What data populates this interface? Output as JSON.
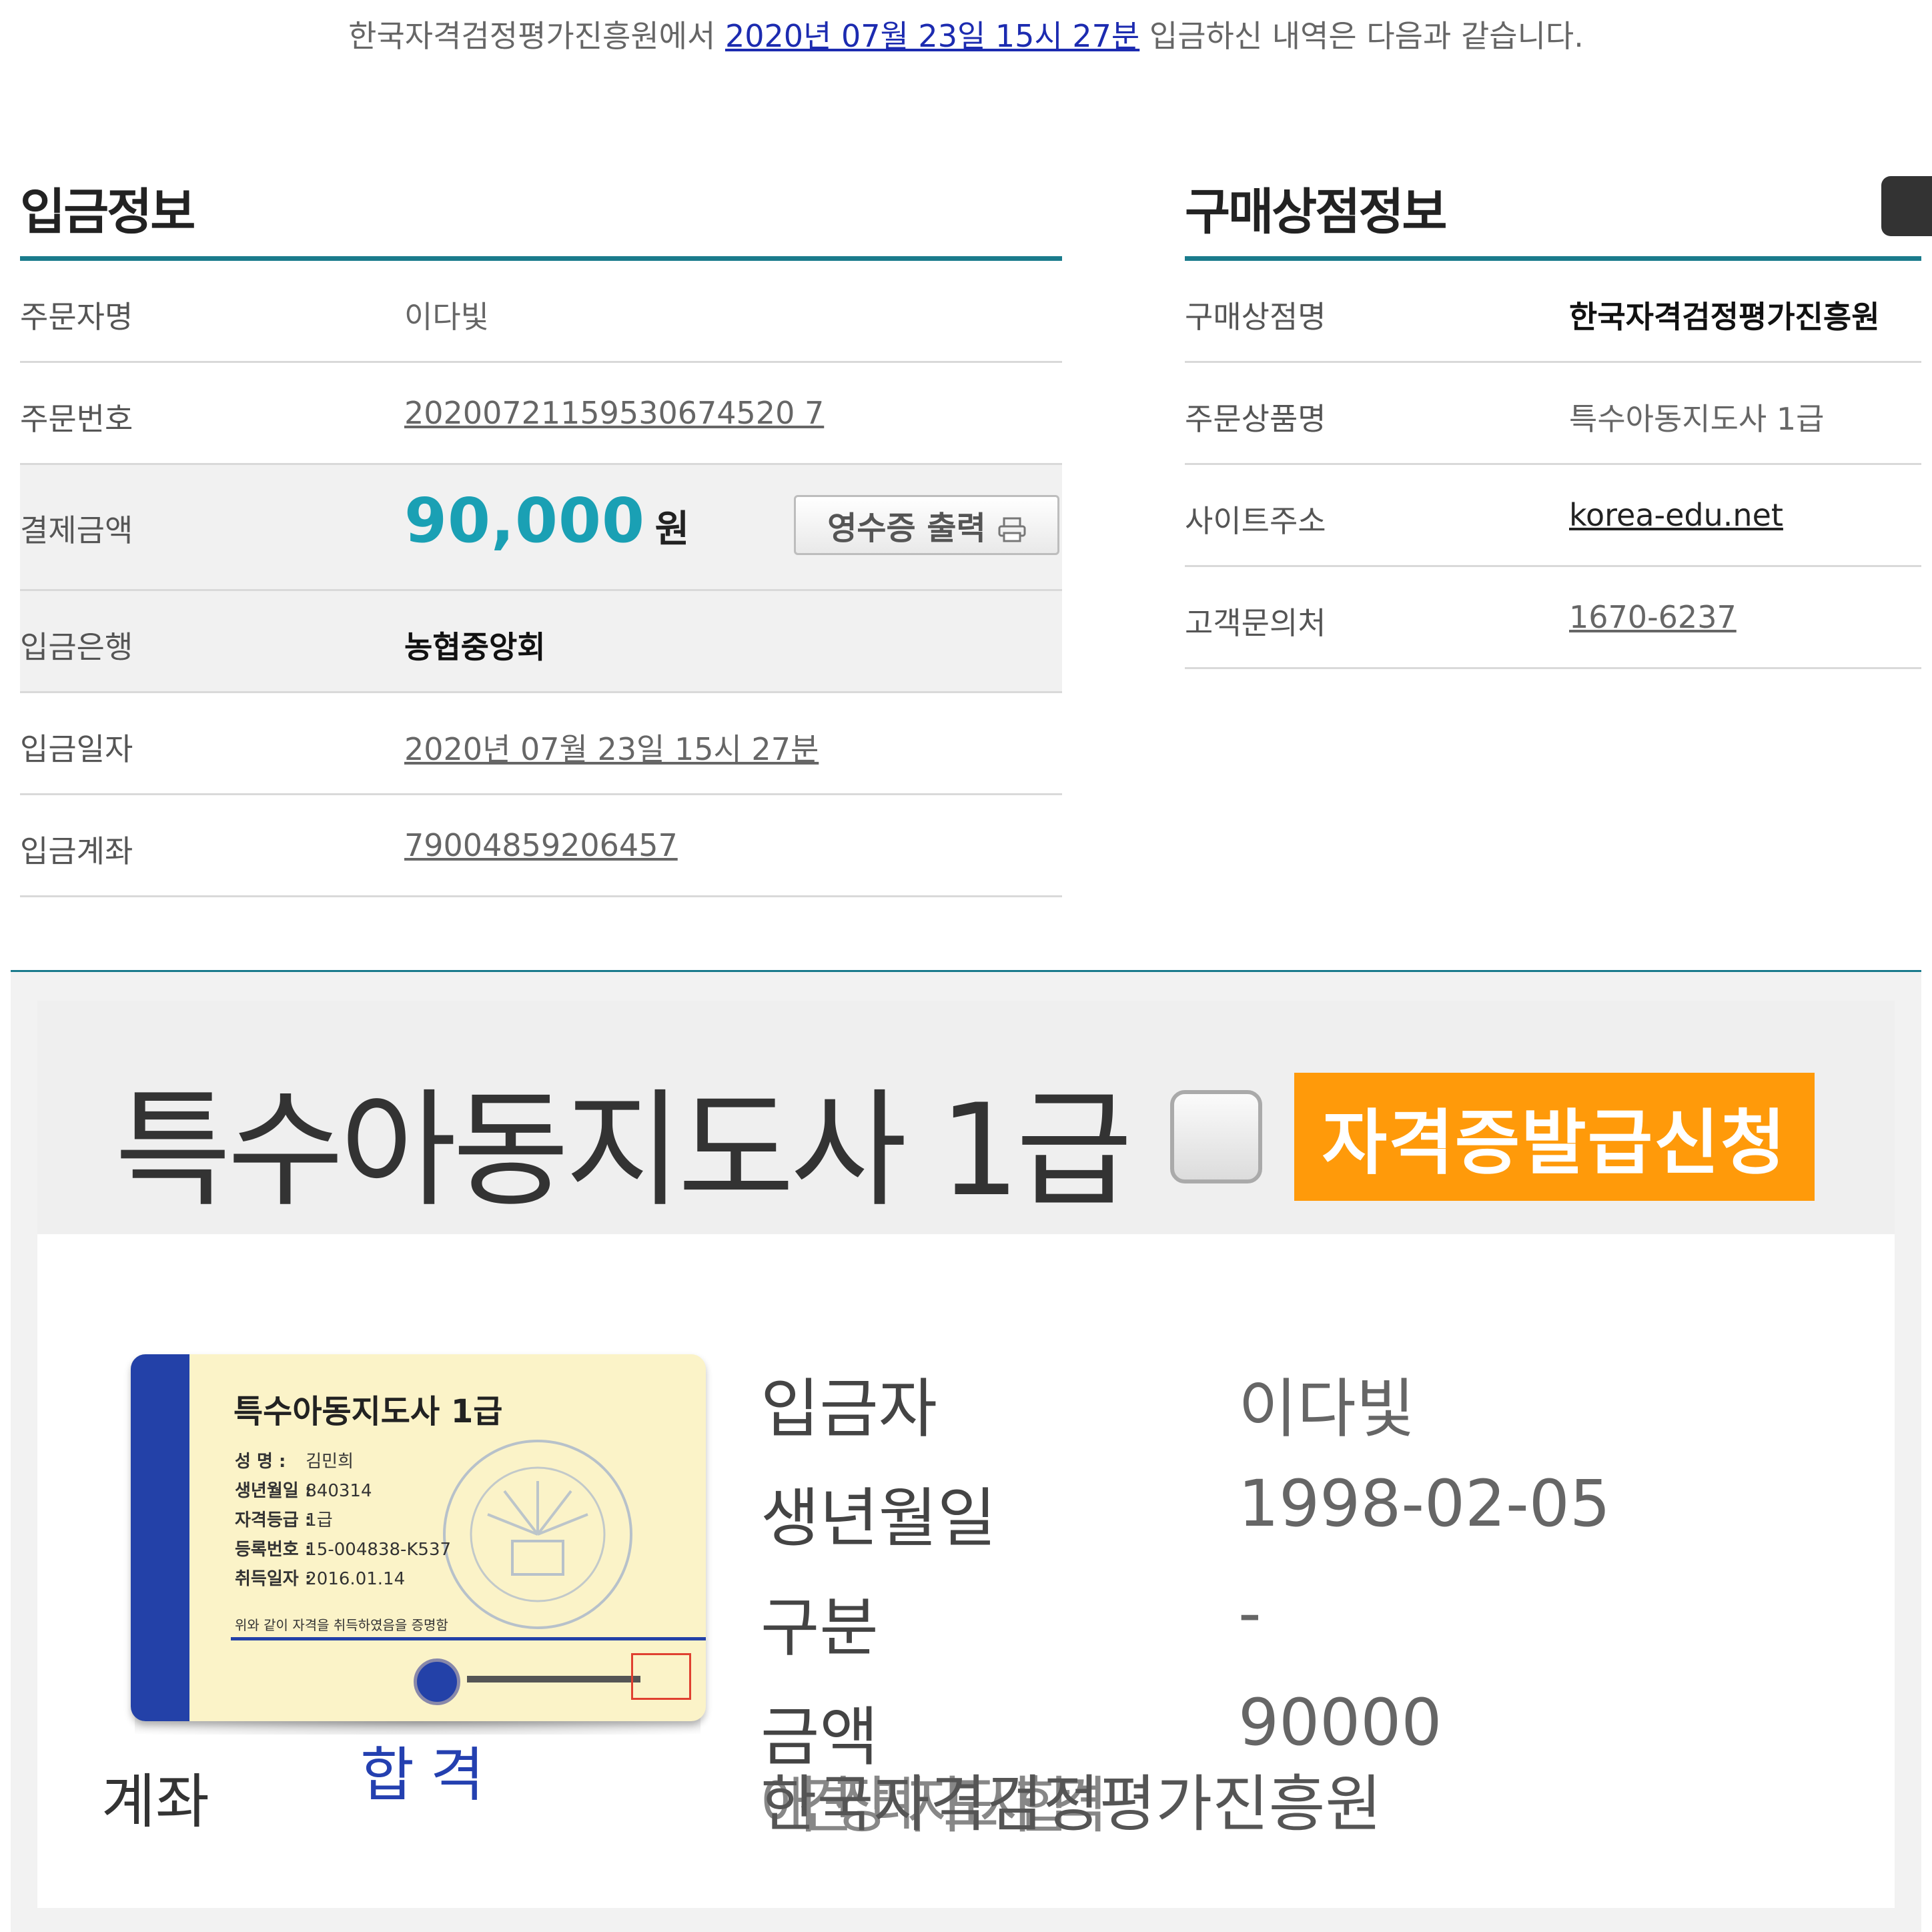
{
  "intro": {
    "prefix": "한국자격검정평가진흥원에서 ",
    "date_link": "2020년 07월 23일 15시 27분",
    "suffix": " 입금하신 내역은 다음과 같습니다."
  },
  "deposit_info": {
    "title": "입금정보",
    "rows": [
      {
        "label": "주문자명",
        "value": "이다빛"
      },
      {
        "label": "주문번호",
        "value": "20200721159530674520 7"
      },
      {
        "label": "결제금액",
        "value": "90,000",
        "unit": "원"
      },
      {
        "label": "입금은행",
        "value": "농협중앙회"
      },
      {
        "label": "입금일자",
        "value": "2020년 07월 23일 15시 27분"
      },
      {
        "label": "입금계좌",
        "value": "79004859206457"
      }
    ],
    "receipt_button": "영수증 출력"
  },
  "store_info": {
    "title": "구매상점정보",
    "rows": [
      {
        "label": "구매상점명",
        "value": "한국자격검정평가진흥원"
      },
      {
        "label": "주문상품명",
        "value": "특수아동지도사 1급"
      },
      {
        "label": "사이트주소",
        "value": "korea-edu.net"
      },
      {
        "label": "고객문의처",
        "value": "1670-6237"
      }
    ]
  },
  "certificate": {
    "title": "특수아동지도사 1급",
    "apply_button": "자격증발급신청",
    "card": {
      "name": "특수아동지도사 1급",
      "fields": [
        {
          "label": "성 명 :",
          "value": "김민희"
        },
        {
          "label": "생년월일 :",
          "value": "840314"
        },
        {
          "label": "자격등급 :",
          "value": "1급"
        },
        {
          "label": "등록번호 :",
          "value": "15-004838-K537"
        },
        {
          "label": "취득일자 :",
          "value": "2016.01.14"
        }
      ],
      "note": "위와 같이 자격을 취득하였음을 증명함"
    },
    "caption_left": "계좌",
    "caption_pass": "합격",
    "details": [
      {
        "label": "입금자",
        "value": "이다빛"
      },
      {
        "label": "생년월일",
        "value": "1998-02-05"
      },
      {
        "label": "구분",
        "value": "-"
      },
      {
        "label": "금액",
        "value": "90000"
      }
    ],
    "overlap_text_a": "한국자격검정평가진흥원",
    "overlap_text_b": "애견장례지도사 합격"
  },
  "colors": {
    "accent_teal": "#1a7b8c",
    "amount_blue": "#1aa0b4",
    "link_blue": "#1c2bb0",
    "apply_orange": "#ff9a0a",
    "card_blue": "#2341a8"
  }
}
